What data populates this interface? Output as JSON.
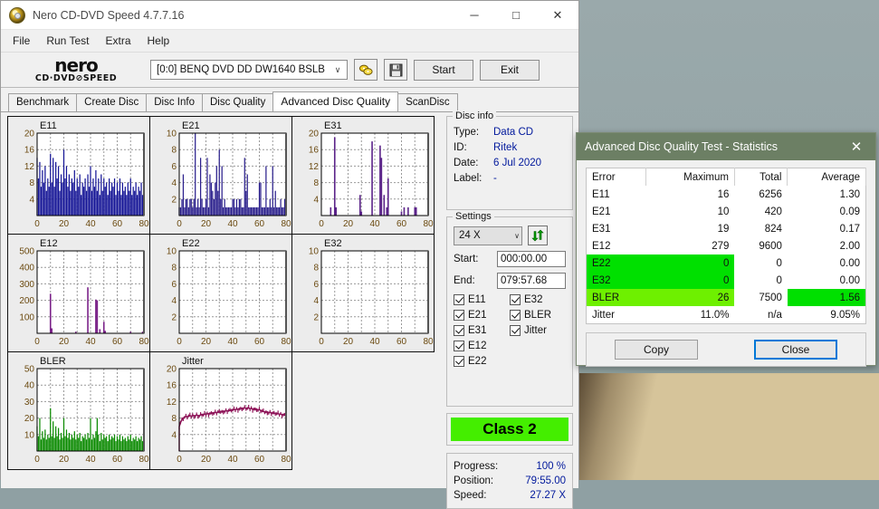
{
  "window": {
    "title": "Nero CD-DVD Speed 4.7.7.16",
    "icon": "disc-icon",
    "minimize": "─",
    "maximize": "□",
    "close": "✕"
  },
  "menu": [
    "File",
    "Run Test",
    "Extra",
    "Help"
  ],
  "toolbar": {
    "logo_line1": "nero",
    "logo_line2": "CD·DVD⊘SPEED",
    "drive": "[0:0]   BENQ DVD DD DW1640 BSLB",
    "combo_arrow": "∨",
    "eject_icon": "eject-disc-icon",
    "save_icon": "floppy-save-icon",
    "start_label": "Start",
    "exit_label": "Exit"
  },
  "tabs": [
    {
      "label": "Benchmark",
      "active": false
    },
    {
      "label": "Create Disc",
      "active": false
    },
    {
      "label": "Disc Info",
      "active": false
    },
    {
      "label": "Disc Quality",
      "active": false
    },
    {
      "label": "Advanced Disc Quality",
      "active": true
    },
    {
      "label": "ScanDisc",
      "active": false
    }
  ],
  "disc_info": {
    "legend": "Disc info",
    "rows": [
      {
        "key": "Type:",
        "value": "Data CD"
      },
      {
        "key": "ID:",
        "value": "Ritek"
      },
      {
        "key": "Date:",
        "value": "6 Jul 2020"
      },
      {
        "key": "Label:",
        "value": "-"
      }
    ]
  },
  "settings": {
    "legend": "Settings",
    "speed": "24 X",
    "speed_arrow": "∨",
    "refresh_icon": "refresh-icon",
    "start_label": "Start:",
    "start_value": "000:00.00",
    "end_label": "End:",
    "end_value": "079:57.68",
    "checkboxes": [
      {
        "label": "E11",
        "checked": true
      },
      {
        "label": "E32",
        "checked": true
      },
      {
        "label": "E21",
        "checked": true
      },
      {
        "label": "BLER",
        "checked": true
      },
      {
        "label": "E31",
        "checked": true
      },
      {
        "label": "Jitter",
        "checked": true
      },
      {
        "label": "E12",
        "checked": true
      },
      {
        "label": "",
        "checked": false
      },
      {
        "label": "E22",
        "checked": true
      },
      {
        "label": "",
        "checked": false
      }
    ]
  },
  "quality": {
    "class_label": "Class 2",
    "class_color": "#44ee00"
  },
  "progress": {
    "rows": [
      {
        "key": "Progress:",
        "value": "100 %"
      },
      {
        "key": "Position:",
        "value": "79:55.00"
      },
      {
        "key": "Speed:",
        "value": "27.27 X"
      }
    ]
  },
  "dialog": {
    "title": "Advanced Disc Quality Test - Statistics",
    "close_icon": "close-icon",
    "columns": [
      "Error",
      "Maximum",
      "Total",
      "Average"
    ],
    "rows": [
      {
        "error": "E11",
        "maximum": "16",
        "total": "6256",
        "average": "1.30",
        "hl": ""
      },
      {
        "error": "E21",
        "maximum": "10",
        "total": "420",
        "average": "0.09",
        "hl": ""
      },
      {
        "error": "E31",
        "maximum": "19",
        "total": "824",
        "average": "0.17",
        "hl": ""
      },
      {
        "error": "E12",
        "maximum": "279",
        "total": "9600",
        "average": "2.00",
        "hl": ""
      },
      {
        "error": "E22",
        "maximum": "0",
        "total": "0",
        "average": "0.00",
        "hl": "green-left"
      },
      {
        "error": "E32",
        "maximum": "0",
        "total": "0",
        "average": "0.00",
        "hl": "green-left"
      },
      {
        "error": "BLER",
        "maximum": "26",
        "total": "7500",
        "average": "1.56",
        "hl": "lgreen-left-green-avg"
      },
      {
        "error": "Jitter",
        "maximum": "11.0%",
        "total": "n/a",
        "average": "9.05%",
        "hl": ""
      }
    ],
    "copy_label": "Copy",
    "close_label": "Close"
  },
  "chart_data": [
    {
      "type": "bar",
      "title": "E11",
      "xlabel": "",
      "ylabel": "",
      "color": "#151596",
      "fill": true,
      "xlim": [
        0,
        80
      ],
      "ylim": [
        0,
        20
      ],
      "xticks": [
        0,
        20,
        40,
        60,
        80
      ],
      "yticks": [
        4,
        8,
        12,
        16,
        20
      ],
      "grid": true,
      "x": [
        0,
        1,
        2,
        3,
        4,
        5,
        6,
        7,
        8,
        9,
        10,
        11,
        12,
        13,
        14,
        15,
        16,
        17,
        18,
        19,
        20,
        21,
        22,
        23,
        24,
        25,
        26,
        27,
        28,
        29,
        30,
        31,
        32,
        33,
        34,
        35,
        36,
        37,
        38,
        39,
        40,
        41,
        42,
        43,
        44,
        45,
        46,
        47,
        48,
        49,
        50,
        51,
        52,
        53,
        54,
        55,
        56,
        57,
        58,
        59,
        60,
        61,
        62,
        63,
        64,
        65,
        66,
        67,
        68,
        69,
        70,
        71,
        72,
        73,
        74,
        75,
        76,
        77,
        78,
        79,
        80
      ],
      "values": [
        14,
        9,
        13,
        7,
        11,
        8,
        12,
        6,
        9,
        7,
        15,
        8,
        14,
        7,
        13,
        9,
        12,
        6,
        10,
        8,
        16,
        9,
        12,
        7,
        10,
        6,
        9,
        8,
        11,
        6,
        9,
        7,
        10,
        5,
        8,
        7,
        9,
        6,
        10,
        7,
        12,
        6,
        9,
        7,
        11,
        6,
        9,
        5,
        10,
        6,
        9,
        7,
        8,
        5,
        9,
        6,
        8,
        7,
        9,
        5,
        8,
        6,
        9,
        5,
        8,
        6,
        7,
        5,
        8,
        6,
        9,
        5,
        7,
        6,
        8,
        5,
        7,
        6,
        8,
        5,
        7
      ]
    },
    {
      "type": "bar",
      "title": "E21",
      "xlabel": "",
      "ylabel": "",
      "color": "#2a1f8c",
      "fill": true,
      "xlim": [
        0,
        80
      ],
      "ylim": [
        0,
        10
      ],
      "xticks": [
        0,
        20,
        40,
        60,
        80
      ],
      "yticks": [
        2,
        4,
        6,
        8,
        10
      ],
      "grid": true,
      "x": [
        0,
        1,
        2,
        3,
        4,
        5,
        6,
        7,
        8,
        9,
        10,
        11,
        12,
        13,
        14,
        15,
        16,
        17,
        18,
        19,
        20,
        21,
        22,
        23,
        24,
        25,
        26,
        27,
        28,
        29,
        30,
        31,
        32,
        33,
        34,
        35,
        36,
        37,
        38,
        39,
        40,
        41,
        42,
        43,
        44,
        45,
        46,
        47,
        48,
        49,
        50,
        51,
        52,
        53,
        54,
        55,
        56,
        57,
        58,
        59,
        60,
        61,
        62,
        63,
        64,
        65,
        66,
        67,
        68,
        69,
        70,
        71,
        72,
        73,
        74,
        75,
        76,
        77,
        78,
        79,
        80
      ],
      "values": [
        1,
        1,
        2,
        5,
        1,
        2,
        2,
        1,
        2,
        2,
        1,
        2,
        10,
        1,
        2,
        1,
        7,
        2,
        1,
        1,
        2,
        7,
        1,
        5,
        4,
        3,
        2,
        4,
        6,
        3,
        8,
        2,
        6,
        1,
        2,
        1,
        1,
        1,
        1,
        1,
        2,
        2,
        1,
        2,
        1,
        2,
        2,
        1,
        1,
        7,
        3,
        5,
        1,
        1,
        1,
        1,
        1,
        1,
        1,
        1,
        4,
        4,
        1,
        1,
        1,
        6,
        1,
        1,
        2,
        1,
        6,
        1,
        3,
        1,
        1,
        1,
        2,
        1,
        1,
        2,
        2
      ]
    },
    {
      "type": "bar",
      "title": "E31",
      "xlabel": "",
      "ylabel": "",
      "color": "#5a2288",
      "fill": false,
      "xlim": [
        0,
        80
      ],
      "ylim": [
        0,
        20
      ],
      "xticks": [
        0,
        20,
        40,
        60,
        80
      ],
      "yticks": [
        4,
        8,
        12,
        16,
        20
      ],
      "grid": true,
      "x": [
        7,
        10,
        11,
        29,
        30,
        38,
        44,
        45,
        47,
        49,
        50,
        60,
        62,
        65,
        70,
        71
      ],
      "values": [
        2,
        19,
        2,
        5,
        1,
        18,
        17,
        14,
        5,
        2,
        9,
        1,
        2,
        2,
        2,
        2
      ]
    },
    {
      "type": "bar",
      "title": "E12",
      "xlabel": "",
      "ylabel": "",
      "color": "#7a2288",
      "fill": false,
      "xlim": [
        0,
        80
      ],
      "ylim": [
        0,
        500
      ],
      "xticks": [
        0,
        20,
        40,
        60,
        80
      ],
      "yticks": [
        100,
        200,
        300,
        400,
        500
      ],
      "grid": true,
      "x": [
        10,
        11,
        29,
        38,
        44,
        45,
        47,
        50,
        51,
        70,
        79,
        80
      ],
      "values": [
        240,
        30,
        10,
        279,
        205,
        200,
        25,
        70,
        15,
        10,
        10,
        30
      ]
    },
    {
      "type": "bar",
      "title": "E22",
      "xlabel": "",
      "ylabel": "",
      "color": "#2a1f8c",
      "fill": true,
      "xlim": [
        0,
        80
      ],
      "ylim": [
        0,
        10
      ],
      "xticks": [
        0,
        20,
        40,
        60,
        80
      ],
      "yticks": [
        2,
        4,
        6,
        8,
        10
      ],
      "grid": true,
      "x": [],
      "values": []
    },
    {
      "type": "bar",
      "title": "E32",
      "xlabel": "",
      "ylabel": "",
      "color": "#2a1f8c",
      "fill": true,
      "xlim": [
        0,
        80
      ],
      "ylim": [
        0,
        10
      ],
      "xticks": [
        0,
        20,
        40,
        60,
        80
      ],
      "yticks": [
        2,
        4,
        6,
        8,
        10
      ],
      "grid": true,
      "x": [],
      "values": []
    },
    {
      "type": "bar",
      "title": "BLER",
      "xlabel": "",
      "ylabel": "",
      "color": "#0a8a00",
      "fill": true,
      "xlim": [
        0,
        80
      ],
      "ylim": [
        0,
        50
      ],
      "xticks": [
        0,
        20,
        40,
        60,
        80
      ],
      "yticks": [
        10,
        20,
        30,
        40,
        50
      ],
      "grid": true,
      "x": [
        0,
        1,
        2,
        3,
        4,
        5,
        6,
        7,
        8,
        9,
        10,
        11,
        12,
        13,
        14,
        15,
        16,
        17,
        18,
        19,
        20,
        21,
        22,
        23,
        24,
        25,
        26,
        27,
        28,
        29,
        30,
        31,
        32,
        33,
        34,
        35,
        36,
        37,
        38,
        39,
        40,
        41,
        42,
        43,
        44,
        45,
        46,
        47,
        48,
        49,
        50,
        51,
        52,
        53,
        54,
        55,
        56,
        57,
        58,
        59,
        60,
        61,
        62,
        63,
        64,
        65,
        66,
        67,
        68,
        69,
        70,
        71,
        72,
        73,
        74,
        75,
        76,
        77,
        78,
        79,
        80
      ],
      "values": [
        15,
        9,
        20,
        7,
        12,
        8,
        13,
        7,
        10,
        8,
        26,
        9,
        18,
        8,
        15,
        9,
        14,
        7,
        11,
        8,
        20,
        9,
        13,
        8,
        11,
        7,
        10,
        8,
        12,
        7,
        10,
        8,
        11,
        6,
        9,
        8,
        10,
        7,
        11,
        8,
        20,
        7,
        10,
        8,
        12,
        20,
        10,
        6,
        11,
        7,
        10,
        8,
        9,
        6,
        10,
        7,
        9,
        8,
        10,
        6,
        9,
        7,
        10,
        6,
        9,
        7,
        8,
        6,
        9,
        7,
        10,
        6,
        8,
        7,
        9,
        6,
        8,
        7,
        9,
        6,
        8
      ]
    },
    {
      "type": "line",
      "title": "Jitter",
      "xlabel": "",
      "ylabel": "",
      "color": "#8e1458",
      "fill": false,
      "xlim": [
        0,
        80
      ],
      "ylim": [
        0,
        20
      ],
      "xticks": [
        0,
        20,
        40,
        60,
        80
      ],
      "yticks": [
        4,
        8,
        12,
        16,
        20
      ],
      "grid": true,
      "x": [
        0,
        1,
        2,
        3,
        4,
        5,
        6,
        7,
        8,
        9,
        10,
        11,
        12,
        13,
        14,
        15,
        16,
        17,
        18,
        19,
        20,
        21,
        22,
        23,
        24,
        25,
        26,
        27,
        28,
        29,
        30,
        31,
        32,
        33,
        34,
        35,
        36,
        37,
        38,
        39,
        40,
        41,
        42,
        43,
        44,
        45,
        46,
        47,
        48,
        49,
        50,
        51,
        52,
        53,
        54,
        55,
        56,
        57,
        58,
        59,
        60,
        61,
        62,
        63,
        64,
        65,
        66,
        67,
        68,
        69,
        70,
        71,
        72,
        73,
        74,
        75,
        76,
        77,
        78,
        79,
        80
      ],
      "values": [
        6.0,
        7.0,
        7.6,
        8.0,
        8.2,
        8.4,
        8.3,
        8.5,
        8.6,
        8.4,
        8.7,
        8.6,
        8.5,
        8.8,
        8.6,
        8.5,
        8.8,
        8.9,
        8.7,
        9.0,
        8.9,
        9.1,
        9.0,
        9.2,
        9.1,
        9.3,
        9.2,
        9.4,
        9.3,
        9.5,
        9.4,
        9.6,
        9.5,
        9.7,
        9.6,
        9.8,
        9.7,
        9.9,
        9.8,
        10.0,
        9.9,
        10.1,
        10.0,
        10.2,
        10.1,
        10.3,
        10.2,
        10.4,
        10.3,
        10.5,
        10.4,
        10.3,
        10.5,
        10.2,
        10.4,
        10.1,
        10.3,
        10.0,
        10.2,
        9.9,
        10.1,
        9.8,
        9.7,
        9.6,
        9.5,
        9.4,
        9.5,
        9.3,
        9.4,
        9.2,
        9.3,
        9.1,
        9.2,
        9.0,
        9.1,
        8.9,
        9.0,
        8.8,
        8.9,
        8.7,
        8.6
      ]
    }
  ]
}
